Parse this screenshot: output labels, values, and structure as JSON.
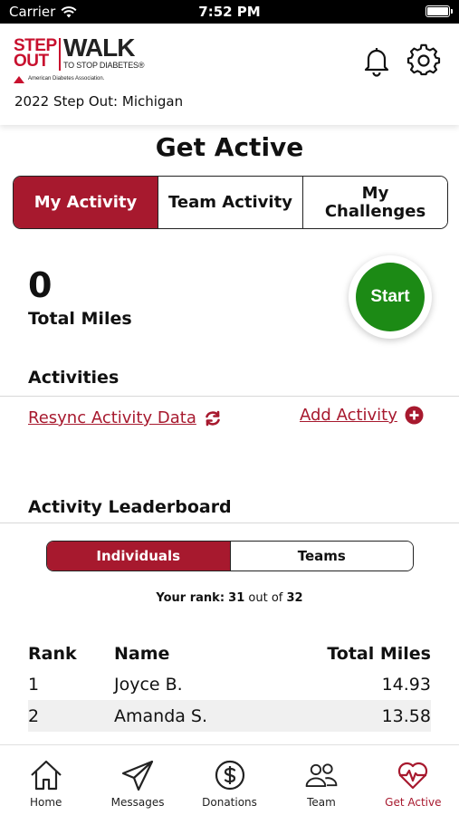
{
  "status_bar": {
    "carrier": "Carrier",
    "time": "7:52 PM"
  },
  "header": {
    "logo": {
      "line1": "STEP",
      "line2": "OUT",
      "walk": "WALK",
      "tagline": "TO STOP DIABETES®",
      "org": "American Diabetes Association."
    },
    "event_name": "2022 Step Out: Michigan"
  },
  "page_title": "Get Active",
  "tabs": [
    {
      "label": "My Activity",
      "active": true
    },
    {
      "label": "Team Activity",
      "active": false
    },
    {
      "label_line1": "My",
      "label_line2": "Challenges",
      "active": false
    }
  ],
  "summary": {
    "total_miles_value": "0",
    "total_miles_label": "Total Miles",
    "start_label": "Start"
  },
  "activities": {
    "heading": "Activities",
    "resync_label": "Resync Activity Data",
    "add_label": "Add Activity "
  },
  "leaderboard": {
    "heading": "Activity Leaderboard",
    "toggle": [
      {
        "label": "Individuals",
        "active": true
      },
      {
        "label": "Teams",
        "active": false
      }
    ],
    "rank_prefix": "Your rank:",
    "rank_value": "31",
    "rank_mid": "out of",
    "rank_total": "32",
    "columns": {
      "rank": "Rank",
      "name": "Name",
      "miles": "Total Miles"
    },
    "rows": [
      {
        "rank": "1",
        "name": "Joyce B.",
        "miles": "14.93"
      },
      {
        "rank": "2",
        "name": "Amanda S.",
        "miles": "13.58"
      }
    ]
  },
  "tab_bar": {
    "items": [
      {
        "label": "Home",
        "icon": "home-icon"
      },
      {
        "label": "Messages",
        "icon": "paper-plane-icon"
      },
      {
        "label": "Donations",
        "icon": "dollar-circle-icon"
      },
      {
        "label": "Team",
        "icon": "team-icon"
      },
      {
        "label": "Get Active",
        "icon": "heartbeat-icon",
        "active": true
      }
    ]
  },
  "colors": {
    "brand_red": "#a7192e",
    "start_green": "#1c8a15"
  }
}
